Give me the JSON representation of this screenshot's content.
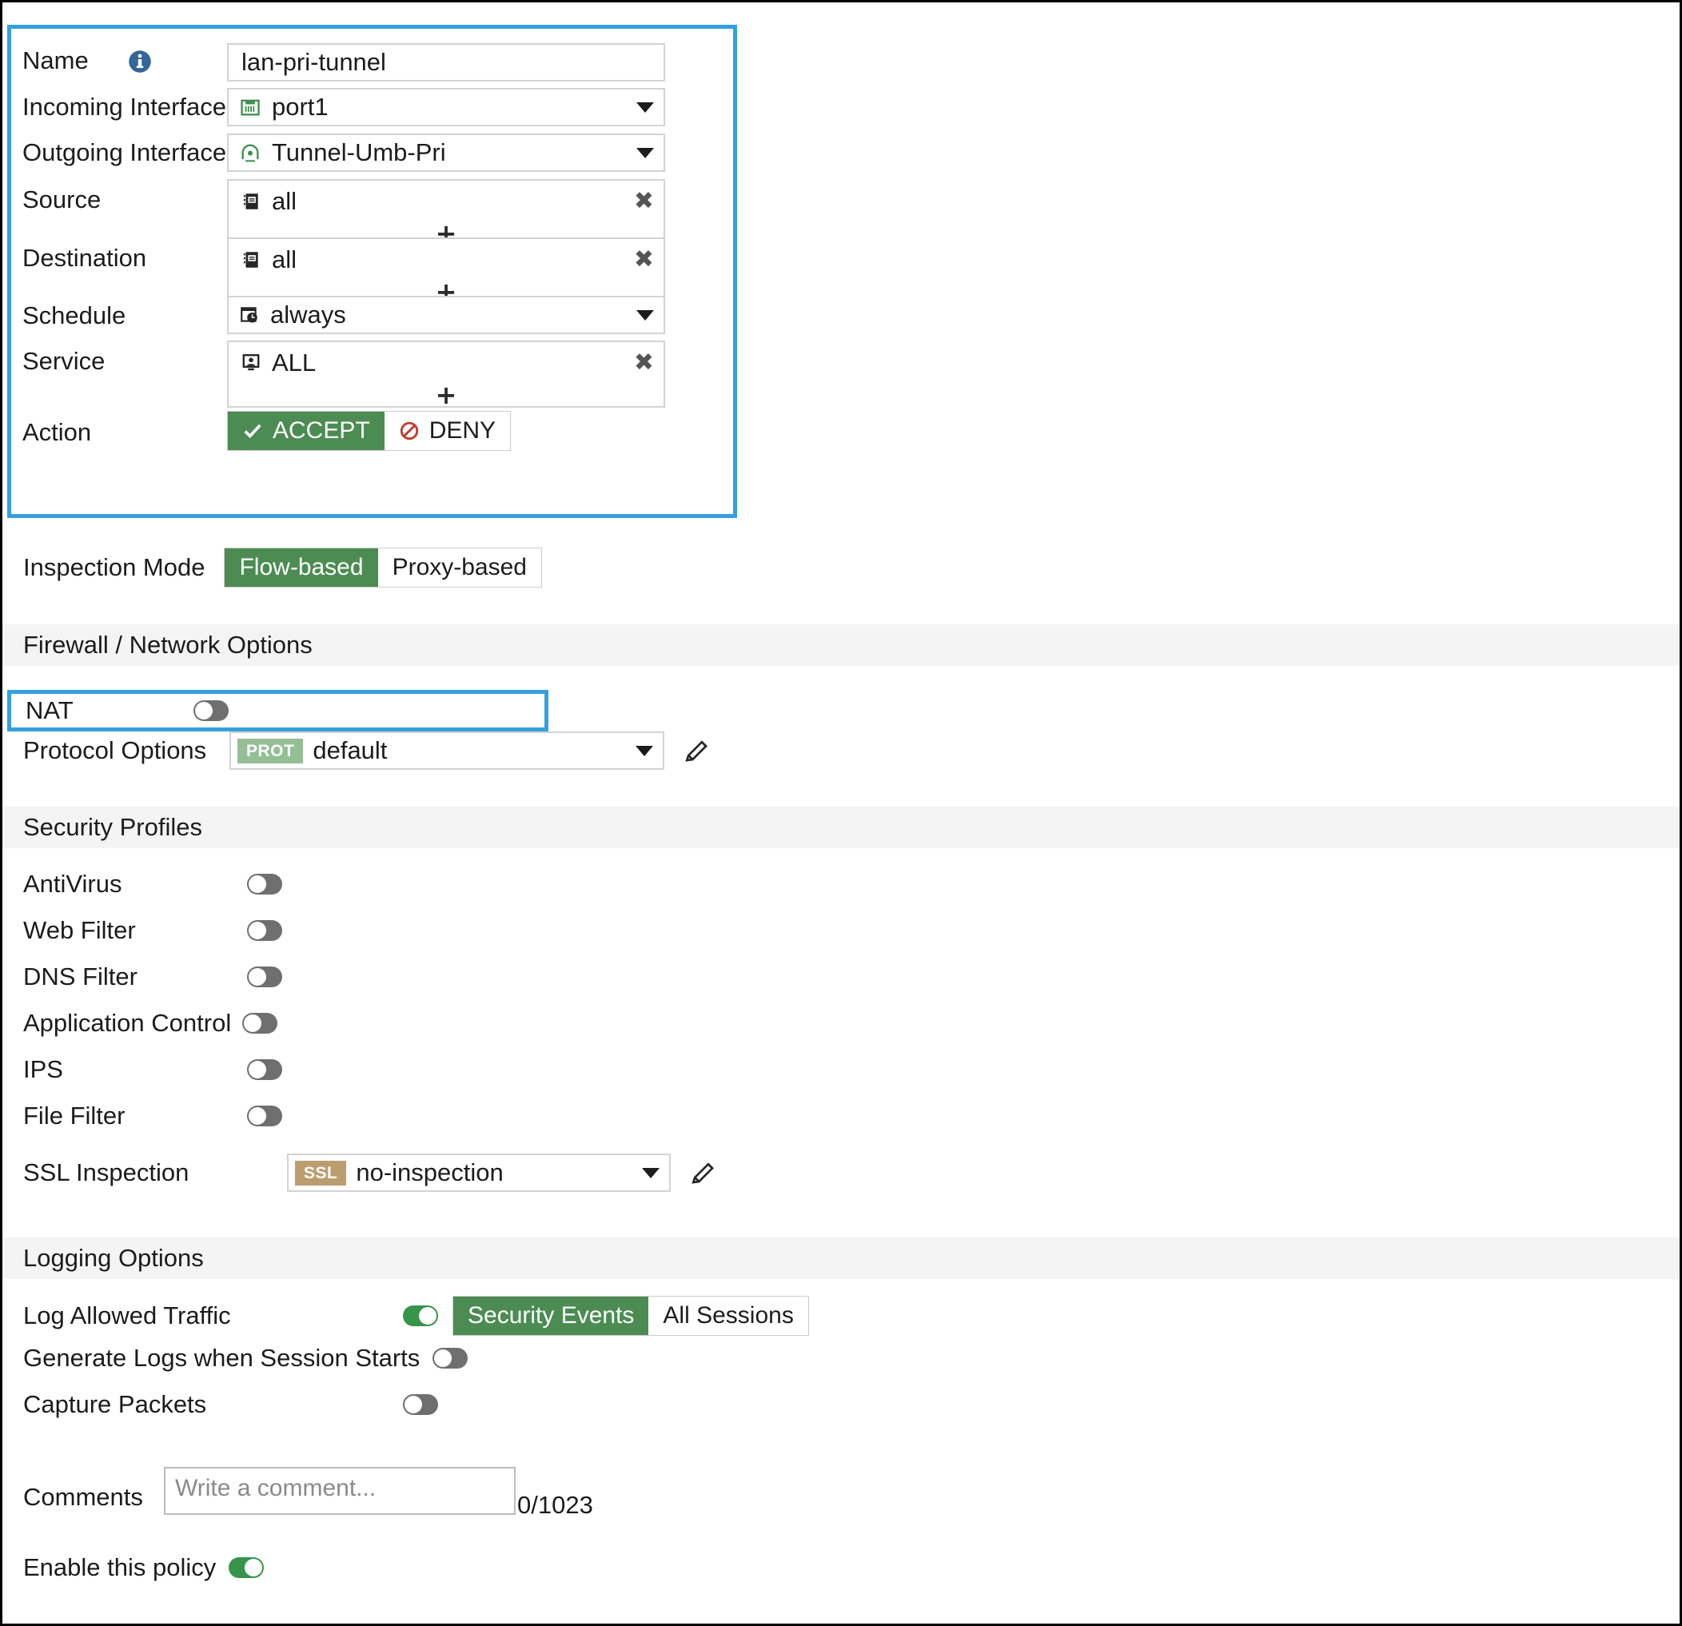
{
  "policy": {
    "name": {
      "label": "Name",
      "value": "lan-pri-tunnel",
      "info_icon": "info-icon"
    },
    "incoming_interface": {
      "label": "Incoming Interface",
      "value": "port1",
      "icon": "ethernet-port-icon"
    },
    "outgoing_interface": {
      "label": "Outgoing Interface",
      "value": "Tunnel-Umb-Pri",
      "icon": "tunnel-icon"
    },
    "source": {
      "label": "Source",
      "items": [
        "all"
      ],
      "item_icon": "address-book-icon",
      "remove_label": "✖",
      "add_label": "+"
    },
    "destination": {
      "label": "Destination",
      "items": [
        "all"
      ],
      "item_icon": "address-book-icon",
      "remove_label": "✖",
      "add_label": "+"
    },
    "schedule": {
      "label": "Schedule",
      "value": "always",
      "icon": "calendar-clock-icon"
    },
    "service": {
      "label": "Service",
      "items": [
        "ALL"
      ],
      "item_icon": "service-monitor-icon",
      "remove_label": "✖",
      "add_label": "+"
    },
    "action": {
      "label": "Action",
      "options": [
        "ACCEPT",
        "DENY"
      ],
      "selected": "ACCEPT"
    }
  },
  "inspection_mode": {
    "label": "Inspection Mode",
    "options": [
      "Flow-based",
      "Proxy-based"
    ],
    "selected": "Flow-based"
  },
  "firewall_network_options": {
    "section_title": "Firewall / Network Options",
    "nat": {
      "label": "NAT",
      "enabled": false
    },
    "protocol_options": {
      "label": "Protocol Options",
      "badge": "PROT",
      "value": "default",
      "edit_icon": "pencil-icon"
    }
  },
  "security_profiles": {
    "section_title": "Security Profiles",
    "toggles": [
      {
        "label": "AntiVirus",
        "enabled": false
      },
      {
        "label": "Web Filter",
        "enabled": false
      },
      {
        "label": "DNS Filter",
        "enabled": false
      },
      {
        "label": "Application Control",
        "enabled": false
      },
      {
        "label": "IPS",
        "enabled": false
      },
      {
        "label": "File Filter",
        "enabled": false
      }
    ],
    "ssl_inspection": {
      "label": "SSL Inspection",
      "badge": "SSL",
      "value": "no-inspection",
      "edit_icon": "pencil-icon"
    }
  },
  "logging_options": {
    "section_title": "Logging Options",
    "log_allowed_traffic": {
      "label": "Log Allowed Traffic",
      "enabled": true,
      "options": [
        "Security Events",
        "All Sessions"
      ],
      "selected": "Security Events"
    },
    "generate_logs_session_start": {
      "label": "Generate Logs when Session Starts",
      "enabled": false
    },
    "capture_packets": {
      "label": "Capture Packets",
      "enabled": false
    }
  },
  "comments": {
    "label": "Comments",
    "placeholder": "Write a comment...",
    "value": "",
    "counter": "0/1023"
  },
  "enable_policy": {
    "label": "Enable this policy",
    "enabled": true
  },
  "colors": {
    "accent_blue": "#35a0dd",
    "accept_green": "#4c8c52",
    "toggle_on_green": "#37944a",
    "toggle_off_grey": "#6f6f6f",
    "prot_badge": "#94be94",
    "ssl_badge": "#bc9d6e",
    "deny_red": "#c0392b",
    "info_blue": "#336699",
    "section_bg": "#f4f4f4"
  }
}
